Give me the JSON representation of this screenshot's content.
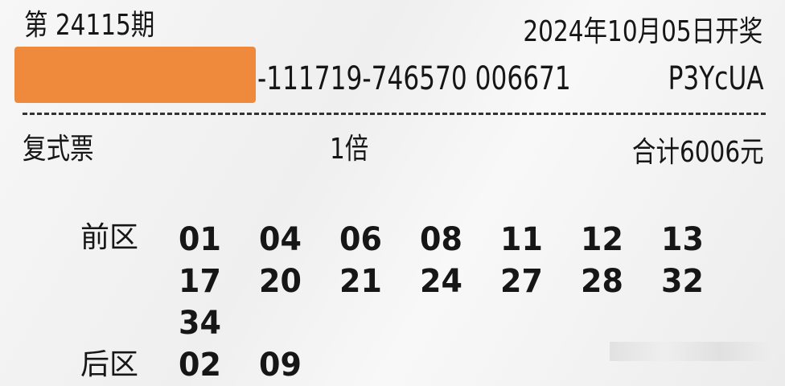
{
  "ticket": {
    "issue": "第 24115期",
    "draw_date": "2024年10月05日开奖",
    "serial": "-111719-746570 006671",
    "code": "P3YcUA",
    "redaction_color": "#ef8a3c",
    "ticket_type": "复式票",
    "multiplier": "1倍",
    "total": "合计6006元",
    "front_label": "前区",
    "back_label": "后区",
    "front_numbers": [
      "01",
      "04",
      "06",
      "08",
      "11",
      "12",
      "13",
      "17",
      "20",
      "21",
      "24",
      "27",
      "28",
      "32",
      "34"
    ],
    "back_numbers": [
      "02",
      "09"
    ]
  }
}
